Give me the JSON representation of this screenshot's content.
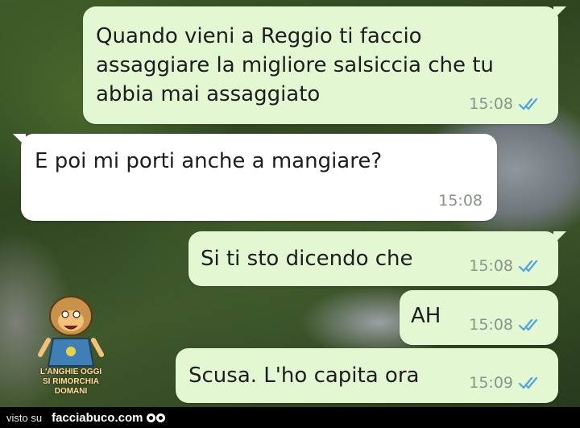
{
  "messages": [
    {
      "direction": "out",
      "lines": [
        "Quando vieni a Reggio ti faccio",
        "assaggiare la migliore salsiccia che tu",
        "abbia mai assaggiato"
      ],
      "time": "15:08",
      "read": true
    },
    {
      "direction": "in",
      "lines": [
        "E poi mi porti anche a mangiare?"
      ],
      "time": "15:08"
    },
    {
      "direction": "out",
      "lines": [
        "Si ti sto dicendo che"
      ],
      "time": "15:08",
      "read": true
    },
    {
      "direction": "out",
      "lines": [
        "AH"
      ],
      "time": "15:08",
      "read": true
    },
    {
      "direction": "out",
      "lines": [
        "Scusa. L'ho capita ora"
      ],
      "time": "15:09",
      "read": true
    }
  ],
  "watermark": {
    "line1": "L'ANGHIE OGGI",
    "line2": "SI RIMORCHIA DOMANI"
  },
  "footer": {
    "visto_su": "visto su",
    "site": "facciabuco.com"
  },
  "colors": {
    "outgoing_bubble": "#e3f8d2",
    "incoming_bubble": "#ffffff",
    "read_ticks": "#4fa3e0",
    "timestamp": "#8a938a"
  },
  "icons": {
    "read_receipt": "double-check-icon",
    "footer_logo": "eyes-icon"
  }
}
